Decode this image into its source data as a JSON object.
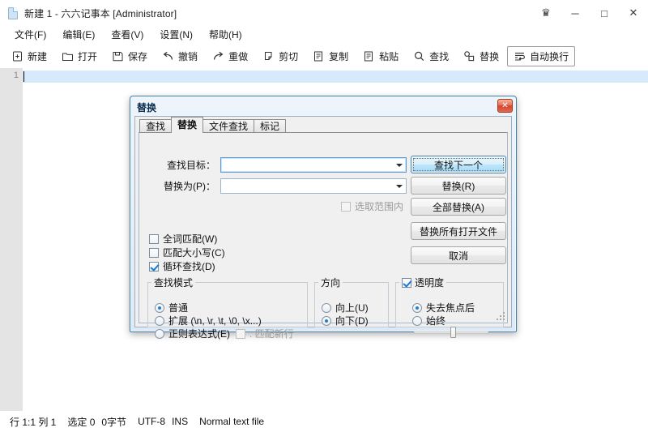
{
  "window": {
    "title": "新建 1 - 六六记事本 [Administrator]",
    "icon": "document-icon",
    "controls": [
      {
        "name": "pin-button",
        "glyph": "♛"
      },
      {
        "name": "minimize-button",
        "glyph": "─"
      },
      {
        "name": "maximize-button",
        "glyph": "□"
      },
      {
        "name": "close-button",
        "glyph": "✕"
      }
    ]
  },
  "menubar": {
    "items": [
      {
        "label": "文件(F)",
        "name": "menu-file"
      },
      {
        "label": "编辑(E)",
        "name": "menu-edit"
      },
      {
        "label": "查看(V)",
        "name": "menu-view"
      },
      {
        "label": "设置(N)",
        "name": "menu-settings"
      },
      {
        "label": "帮助(H)",
        "name": "menu-help"
      }
    ]
  },
  "toolbar": {
    "items": [
      {
        "label": "新建",
        "icon": "new-file-icon"
      },
      {
        "label": "打开",
        "icon": "open-folder-icon"
      },
      {
        "label": "保存",
        "icon": "save-disk-icon"
      },
      {
        "label": "撤销",
        "icon": "undo-arrow-icon"
      },
      {
        "label": "重做",
        "icon": "redo-arrow-icon"
      },
      {
        "label": "剪切",
        "icon": "cut-scissors-icon"
      },
      {
        "label": "复制",
        "icon": "copy-icon"
      },
      {
        "label": "粘贴",
        "icon": "paste-icon"
      },
      {
        "label": "查找",
        "icon": "search-icon"
      },
      {
        "label": "替换",
        "icon": "replace-icon"
      },
      {
        "label": "自动换行",
        "icon": "word-wrap-icon",
        "boxed": true
      }
    ]
  },
  "editor": {
    "line_number": "1",
    "content": ""
  },
  "statusbar": {
    "position": "行 1:1  列 1",
    "selection": "选定 0",
    "bytes": "0字节",
    "encoding": "UTF-8",
    "insert_mode": "INS",
    "file_type": "Normal text file"
  },
  "dialog": {
    "title": "替换",
    "close_glyph": "✕",
    "tabs": [
      {
        "label": "查找",
        "name": "tab-find",
        "active": false
      },
      {
        "label": "替换",
        "name": "tab-replace",
        "active": true
      },
      {
        "label": "文件查找",
        "name": "tab-find-in-files",
        "active": false
      },
      {
        "label": "标记",
        "name": "tab-mark",
        "active": false
      }
    ],
    "fields": [
      {
        "label": "查找目标：",
        "name": "find-what-combo",
        "value": "",
        "focused": true
      },
      {
        "label": "替换为(P)：",
        "name": "replace-with-combo",
        "value": "",
        "focused": false
      }
    ],
    "in_selection": {
      "label": "选取范围内",
      "checked": false,
      "disabled": true
    },
    "buttons": [
      {
        "label": "查找下一个",
        "name": "find-next-button",
        "default": true
      },
      {
        "label": "替换(R)",
        "name": "replace-button",
        "default": false
      },
      {
        "label": "全部替换(A)",
        "name": "replace-all-button",
        "default": false
      },
      {
        "label": "替换所有打开文件",
        "name": "replace-all-opened-files-button",
        "default": false
      },
      {
        "label": "取消",
        "name": "cancel-button",
        "default": false
      }
    ],
    "options": [
      {
        "label": "全词匹配(W)",
        "name": "match-whole-word-checkbox",
        "checked": false
      },
      {
        "label": "匹配大小写(C)",
        "name": "match-case-checkbox",
        "checked": false
      },
      {
        "label": "循环查找(D)",
        "name": "wrap-around-checkbox",
        "checked": true
      }
    ],
    "search_mode": {
      "legend": "查找模式",
      "options": [
        {
          "label": "普通",
          "name": "mode-normal-radio",
          "selected": true
        },
        {
          "label": "扩展 (\\n, \\r, \\t, \\0, \\x...)",
          "name": "mode-extended-radio",
          "selected": false
        },
        {
          "label": "正则表达式(E)",
          "name": "mode-regex-radio",
          "selected": false
        }
      ],
      "matches_newline": {
        "label": ". 匹配新行",
        "checked": false,
        "disabled": true
      }
    },
    "direction": {
      "legend": "方向",
      "options": [
        {
          "label": "向上(U)",
          "name": "direction-up-radio",
          "selected": false
        },
        {
          "label": "向下(D)",
          "name": "direction-down-radio",
          "selected": true
        }
      ]
    },
    "transparency": {
      "legend": "透明度",
      "enabled": true,
      "options": [
        {
          "label": "失去焦点后",
          "name": "transparency-on-losing-focus-radio",
          "selected": true
        },
        {
          "label": "始终",
          "name": "transparency-always-radio",
          "selected": false
        }
      ],
      "slider_percent": 52
    }
  }
}
